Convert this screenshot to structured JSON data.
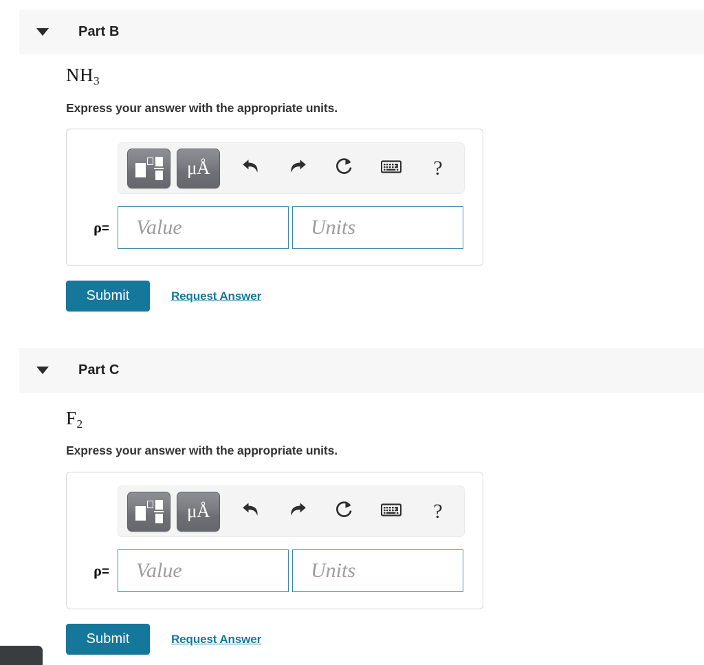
{
  "parts": [
    {
      "id": "part-b",
      "header_label": "Part B",
      "caret_icon": "caret-down-icon",
      "formula_base": "NH",
      "formula_sub": "3",
      "instruction": "Express your answer with the appropriate units.",
      "toolbar": {
        "template_button_icon": "math-template-icon",
        "units_button_label": "μÅ",
        "units_button_icon": "units-icon",
        "undo_icon": "undo-arrow-icon",
        "redo_icon": "redo-arrow-icon",
        "reset_icon": "reset-circular-arrow-icon",
        "keyboard_icon": "keyboard-icon",
        "help_label": "?",
        "help_icon": "question-mark-icon"
      },
      "answer": {
        "variable_label": "ρ",
        "equals_label": "=",
        "value_placeholder": "Value",
        "value_text": "",
        "units_placeholder": "Units",
        "units_text": ""
      },
      "submit_label": "Submit",
      "request_answer_label": "Request Answer"
    },
    {
      "id": "part-c",
      "header_label": "Part C",
      "caret_icon": "caret-down-icon",
      "formula_base": "F",
      "formula_sub": "2",
      "instruction": "Express your answer with the appropriate units.",
      "toolbar": {
        "template_button_icon": "math-template-icon",
        "units_button_label": "μÅ",
        "units_button_icon": "units-icon",
        "undo_icon": "undo-arrow-icon",
        "redo_icon": "redo-arrow-icon",
        "reset_icon": "reset-circular-arrow-icon",
        "keyboard_icon": "keyboard-icon",
        "help_label": "?",
        "help_icon": "question-mark-icon"
      },
      "answer": {
        "variable_label": "ρ",
        "equals_label": "=",
        "value_placeholder": "Value",
        "value_text": "",
        "units_placeholder": "Units",
        "units_text": ""
      },
      "submit_label": "Submit",
      "request_answer_label": "Request Answer"
    }
  ],
  "colors": {
    "accent": "#15789b",
    "header_bg": "#f7f7f7",
    "field_border": "#3f85a8",
    "toolbar_bg": "#f4f4f4",
    "tool_button": "#72747a",
    "text": "#222222",
    "placeholder": "#9d9d9d",
    "toast": "#3a3c40"
  }
}
